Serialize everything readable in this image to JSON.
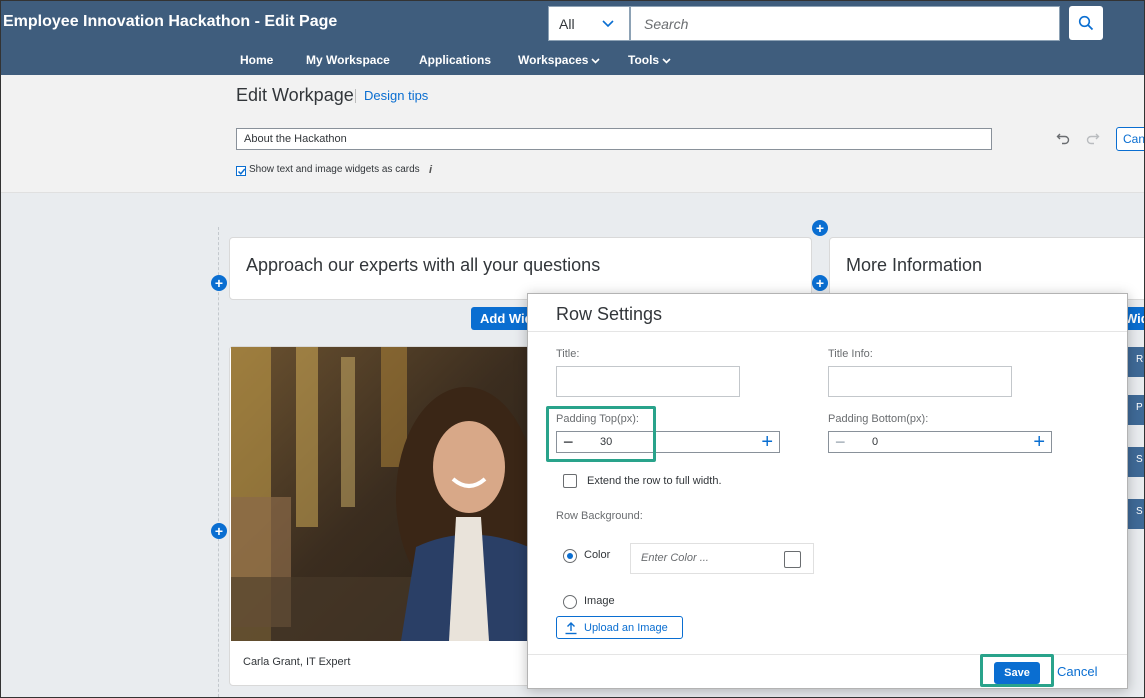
{
  "shell": {
    "title": "Employee Innovation Hackathon - Edit Page",
    "scope_value": "All",
    "search_placeholder": "Search",
    "nav": [
      "Home",
      "My Workspace",
      "Applications",
      "Workspaces",
      "Tools"
    ]
  },
  "editor": {
    "heading": "Edit Workpage",
    "design_tips": "Design tips",
    "page_title_value": "About the Hackathon",
    "cancel_partial": "Can",
    "cards_label": "Show text and image widgets as cards",
    "info_icon": "i"
  },
  "canvas": {
    "card1_title": "Approach our experts with all your questions",
    "card2_title": "More Information",
    "add_widget_label": "Add Widget",
    "add_widget_right": "Widget",
    "side_buttons": [
      "R",
      "P",
      "S",
      "S"
    ],
    "photo_caption": "Carla Grant, IT Expert"
  },
  "dialog": {
    "title": "Row Settings",
    "title_label": "Title:",
    "title_info_label": "Title Info:",
    "padding_top_label": "Padding Top(px):",
    "padding_top_value": "30",
    "padding_bottom_label": "Padding Bottom(px):",
    "padding_bottom_value": "0",
    "extend_label": "Extend the row to full width.",
    "row_background_label": "Row Background:",
    "color_option": "Color",
    "color_placeholder": "Enter Color ...",
    "image_option": "Image",
    "upload_label": "Upload an Image",
    "save_label": "Save",
    "cancel_label": "Cancel"
  },
  "colors": {
    "shell_bg": "#3f5d7d",
    "accent": "#0a6ed1",
    "highlight": "#29a38b"
  }
}
